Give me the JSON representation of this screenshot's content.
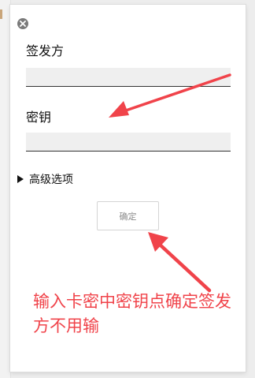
{
  "dialog": {
    "close_icon": "close-circle-icon",
    "issuer_label": "签发方",
    "issuer_value": "",
    "key_label": "密钥",
    "key_value": "",
    "advanced_label": "高级选项",
    "confirm_label": "确定"
  },
  "annotation": {
    "text": "输入卡密中密钥点确定签发方不用输",
    "color": "#f0434a"
  }
}
